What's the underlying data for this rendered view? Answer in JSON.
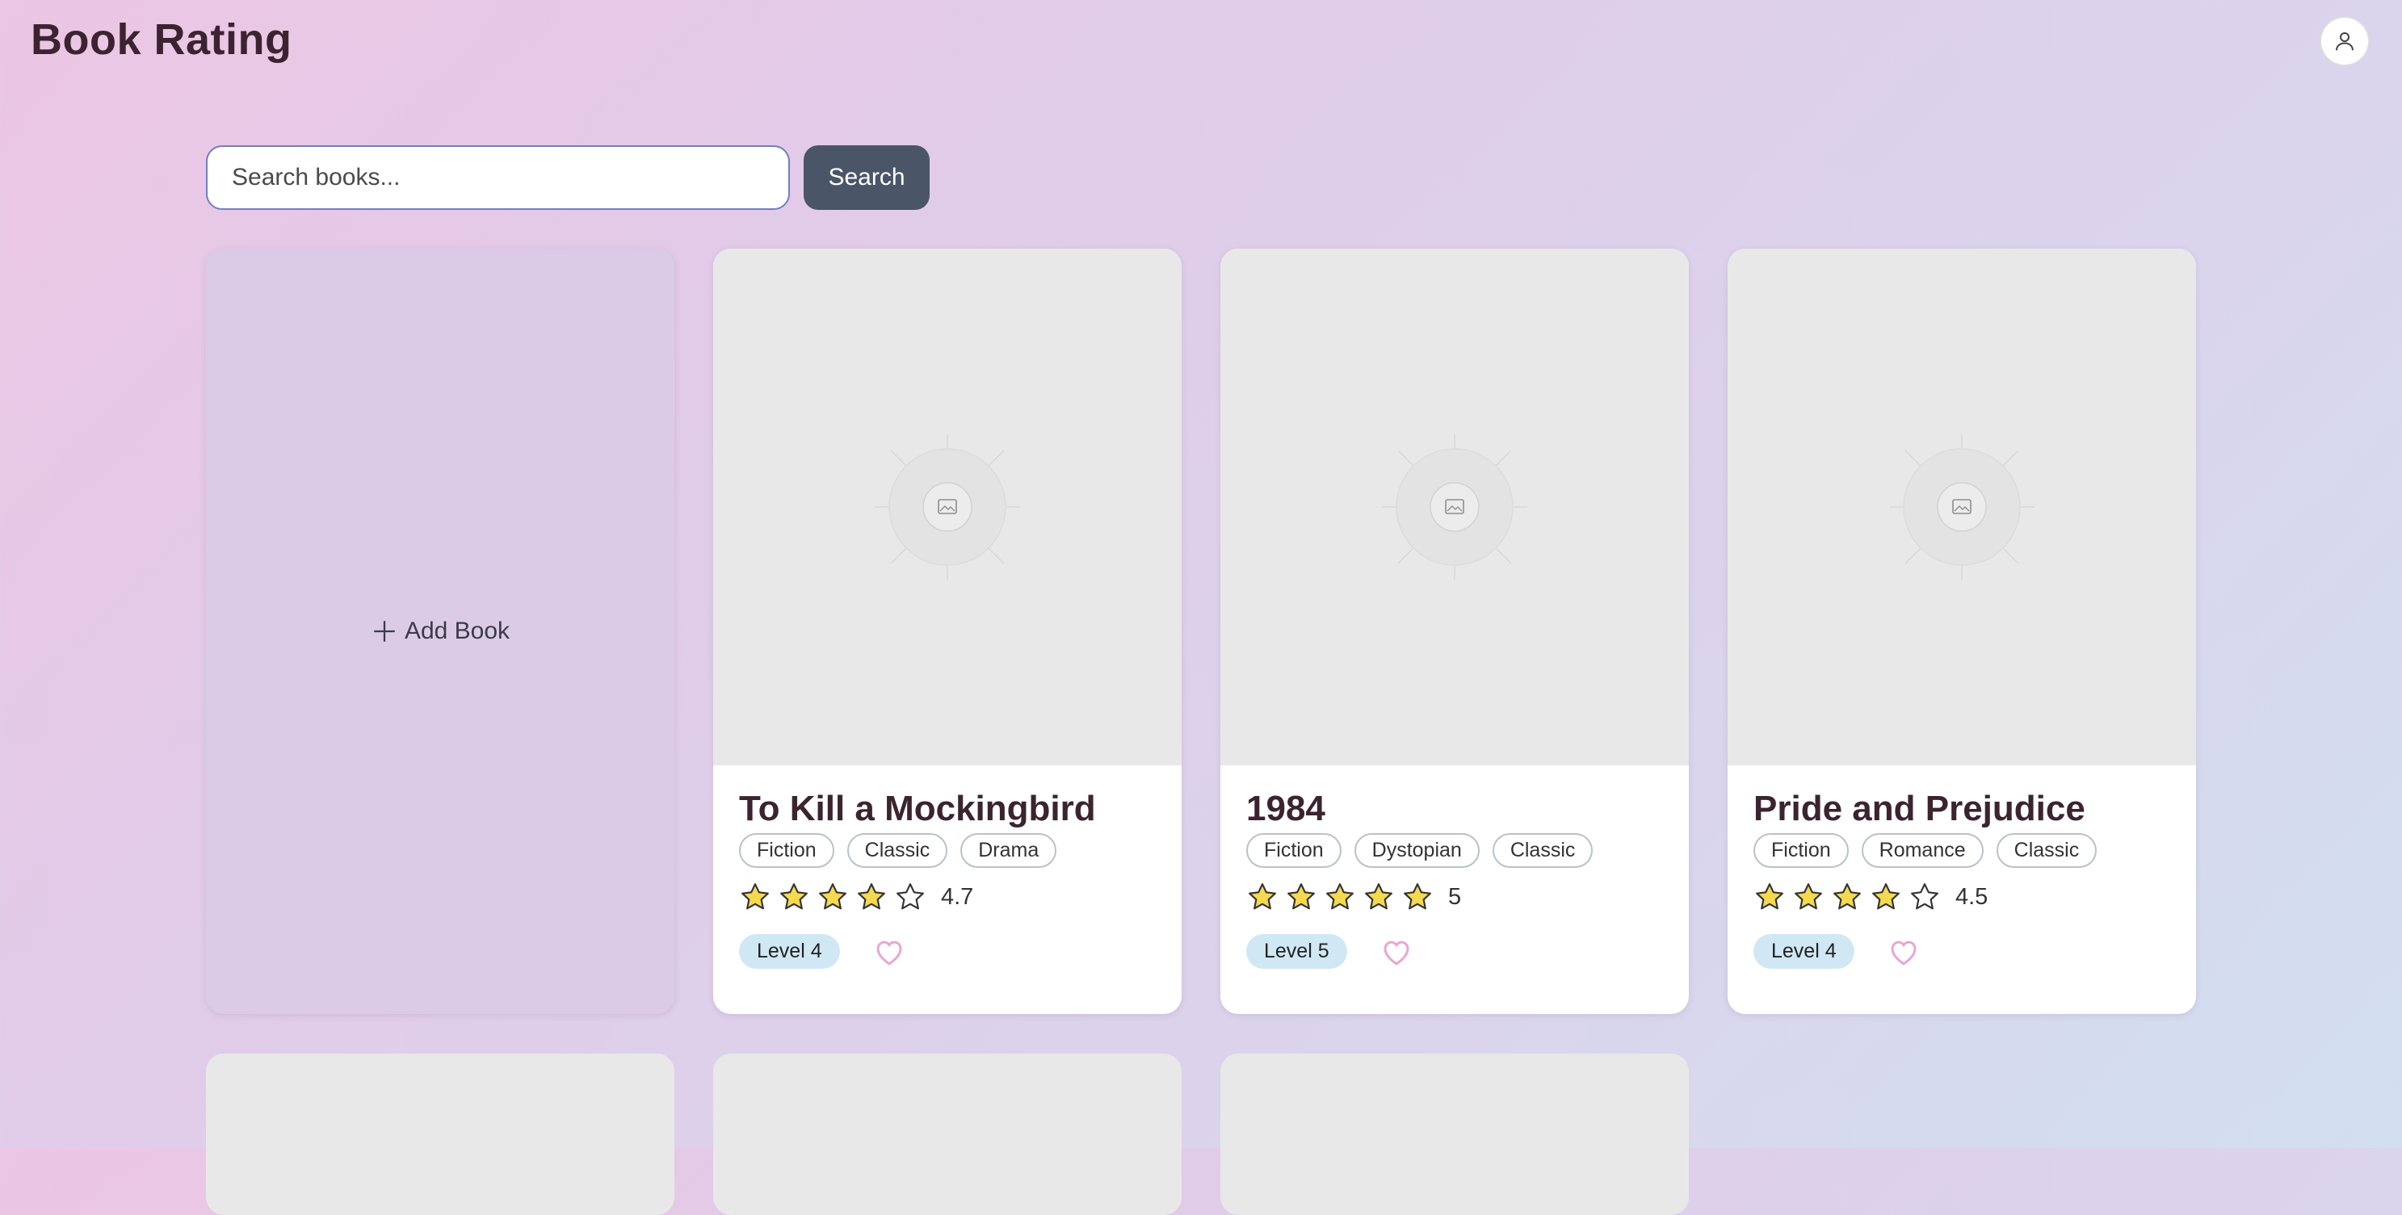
{
  "header": {
    "title": "Book Rating",
    "profile_icon": "user-icon"
  },
  "search": {
    "placeholder": "Search books...",
    "button_label": "Search"
  },
  "add_card": {
    "label": "Add Book",
    "icon": "plus-icon"
  },
  "books": [
    {
      "title": "To Kill a Mockingbird",
      "tags": [
        "Fiction",
        "Classic",
        "Drama"
      ],
      "rating": 4.7,
      "rating_label": "4.7",
      "level": "Level 4",
      "favorited": false
    },
    {
      "title": "1984",
      "tags": [
        "Fiction",
        "Dystopian",
        "Classic"
      ],
      "rating": 5,
      "rating_label": "5",
      "level": "Level 5",
      "favorited": false
    },
    {
      "title": "Pride and Prejudice",
      "tags": [
        "Fiction",
        "Romance",
        "Classic"
      ],
      "rating": 4.5,
      "rating_label": "4.5",
      "level": "Level 4",
      "favorited": false
    }
  ],
  "colors": {
    "accent": "#4a5568",
    "star": "#f5d94e",
    "heart": "#e8a6d6",
    "level_badge": "#cfe8f4"
  }
}
